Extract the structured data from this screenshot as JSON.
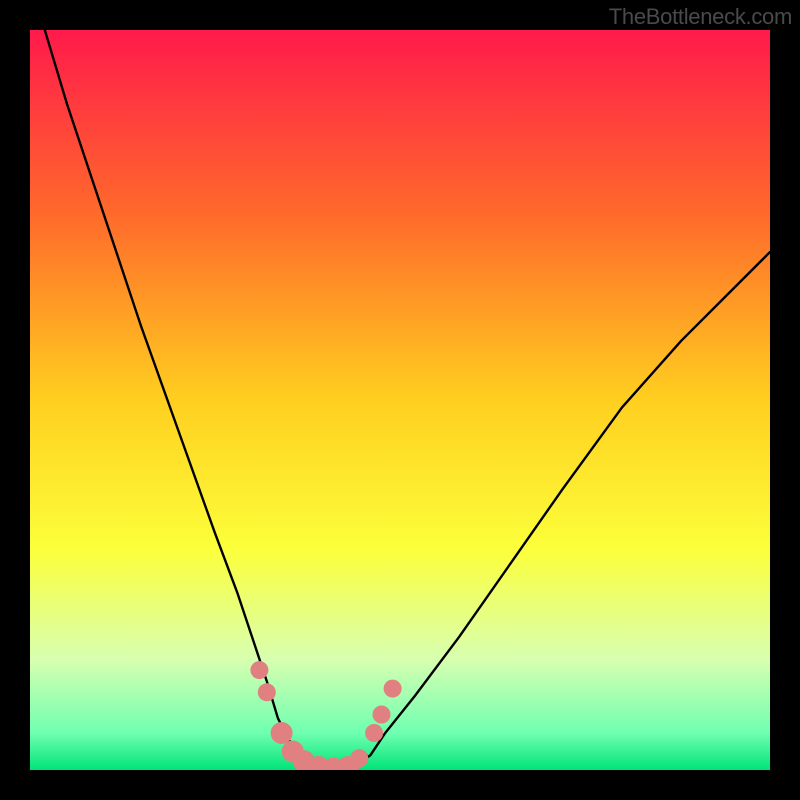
{
  "watermark": "TheBottleneck.com",
  "chart_data": {
    "type": "line",
    "title": "",
    "xlabel": "",
    "ylabel": "",
    "xlim": [
      0,
      100
    ],
    "ylim": [
      0,
      100
    ],
    "gradient_stops": [
      {
        "offset": 0,
        "color": "#ff1a4b"
      },
      {
        "offset": 25,
        "color": "#ff6a2b"
      },
      {
        "offset": 50,
        "color": "#ffcf1f"
      },
      {
        "offset": 70,
        "color": "#fcff3a"
      },
      {
        "offset": 85,
        "color": "#d8ffb0"
      },
      {
        "offset": 95,
        "color": "#6fffb0"
      },
      {
        "offset": 100,
        "color": "#00e47a"
      }
    ],
    "series": [
      {
        "name": "left-curve",
        "x": [
          2,
          5,
          10,
          15,
          20,
          25,
          28,
          30,
          32,
          33.5,
          35,
          36.5,
          38
        ],
        "values": [
          100,
          90,
          75,
          60,
          46,
          32,
          24,
          18,
          12,
          7,
          4,
          2,
          0.5
        ]
      },
      {
        "name": "right-curve",
        "x": [
          44,
          46,
          48,
          52,
          58,
          65,
          72,
          80,
          88,
          95,
          100
        ],
        "values": [
          0.5,
          2,
          5,
          10,
          18,
          28,
          38,
          49,
          58,
          65,
          70
        ]
      },
      {
        "name": "valley-floor",
        "x": [
          36.5,
          38,
          40,
          42,
          44,
          45.5
        ],
        "values": [
          2,
          0.5,
          0,
          0,
          0.5,
          2
        ]
      }
    ],
    "markers": {
      "name": "highlight-dots",
      "color": "#e08080",
      "points": [
        {
          "x": 31.0,
          "y": 13.5,
          "r": 9
        },
        {
          "x": 32.0,
          "y": 10.5,
          "r": 9
        },
        {
          "x": 34.0,
          "y": 5.0,
          "r": 11
        },
        {
          "x": 35.5,
          "y": 2.5,
          "r": 11
        },
        {
          "x": 37.0,
          "y": 1.2,
          "r": 11
        },
        {
          "x": 39.0,
          "y": 0.4,
          "r": 11
        },
        {
          "x": 41.0,
          "y": 0.2,
          "r": 11
        },
        {
          "x": 43.0,
          "y": 0.4,
          "r": 11
        },
        {
          "x": 44.5,
          "y": 1.6,
          "r": 9
        },
        {
          "x": 46.5,
          "y": 5.0,
          "r": 9
        },
        {
          "x": 47.5,
          "y": 7.5,
          "r": 9
        },
        {
          "x": 49.0,
          "y": 11.0,
          "r": 9
        }
      ]
    }
  }
}
